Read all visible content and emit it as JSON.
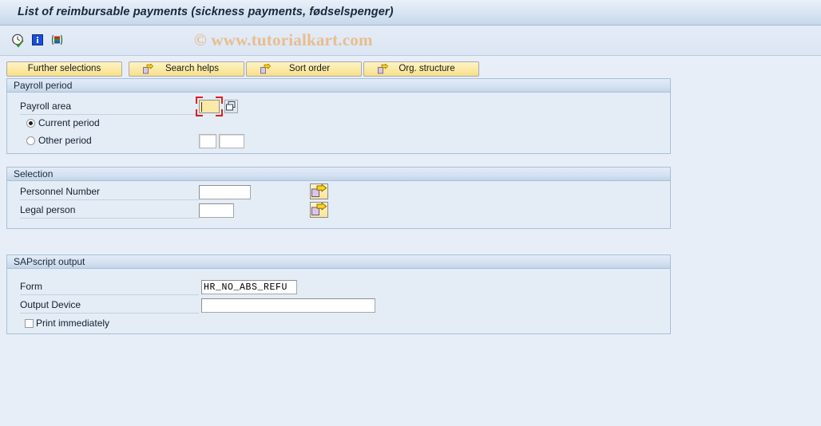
{
  "window": {
    "title": "List of reimbursable payments (sickness payments, fødselspenger)"
  },
  "watermark": {
    "text": "© www.tutorialkart.com"
  },
  "toolbar": {
    "icons": [
      {
        "name": "execute-clock-icon",
        "title": "Execute"
      },
      {
        "name": "info-icon",
        "title": "Information"
      },
      {
        "name": "variant-icon",
        "title": "Get Variant"
      }
    ]
  },
  "buttons": [
    {
      "label": "Further selections",
      "icon": "",
      "name": "further-selections-button"
    },
    {
      "label": "Search helps",
      "icon": "arrow-right-icon",
      "name": "search-helps-button"
    },
    {
      "label": "Sort order",
      "icon": "arrow-right-icon",
      "name": "sort-order-button"
    },
    {
      "label": "Org. structure",
      "icon": "arrow-right-icon",
      "name": "org-structure-button"
    }
  ],
  "payroll_period": {
    "title": "Payroll period",
    "payroll_area": {
      "label": "Payroll area",
      "value": "",
      "matchcode": "matchcode-icon"
    },
    "current_period": {
      "label": "Current period",
      "selected": true
    },
    "other_period": {
      "label": "Other period",
      "selected": false,
      "period_value": "",
      "year_value": ""
    }
  },
  "selection": {
    "title": "Selection",
    "fields": [
      {
        "label": "Personnel Number",
        "value": "",
        "name": "personnel-number-field",
        "multi_button": "multiple-selection-button"
      },
      {
        "label": "Legal person",
        "value": "",
        "name": "legal-person-field",
        "multi_button": "multiple-selection-button"
      }
    ]
  },
  "sapscript_output": {
    "title": "SAPscript output",
    "form": {
      "label": "Form",
      "value": "HR_NO_ABS_REFU"
    },
    "output_device": {
      "label": "Output Device",
      "value": ""
    },
    "print_immediately": {
      "label": "Print immediately",
      "checked": false
    }
  },
  "colors": {
    "background": "#e8eef7",
    "group_bg": "#e4ecf6",
    "button_yellow": "#fbe9a2",
    "focus_red": "#e02020",
    "watermark": "#e8bd8e"
  }
}
